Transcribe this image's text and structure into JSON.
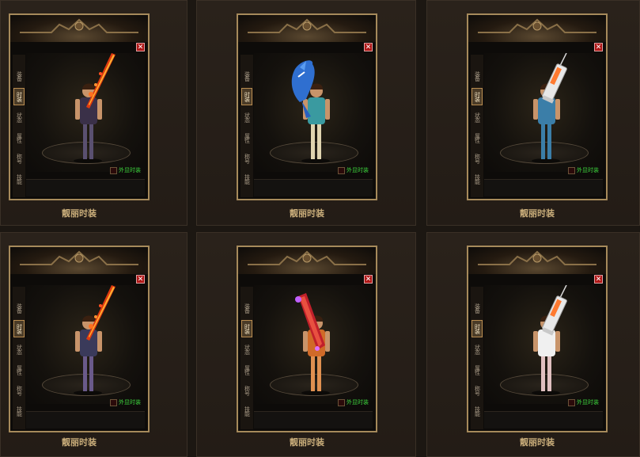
{
  "tabs": [
    "装备",
    "时装",
    "状态",
    "属性",
    "称号",
    "技能"
  ],
  "active_tab_index": 1,
  "close_symbol": "✕",
  "fashion_label": "外显时装",
  "cards": [
    {
      "caption": "靓丽时装",
      "weapon": "flame-sword",
      "outfit": "dark-robe"
    },
    {
      "caption": "靓丽时装",
      "weapon": "shark",
      "outfit": "hawaiian-shirt"
    },
    {
      "caption": "靓丽时装",
      "weapon": "syringe",
      "outfit": "blue-scrubs"
    },
    {
      "caption": "靓丽时装",
      "weapon": "flame-sword",
      "outfit": "dark-dress"
    },
    {
      "caption": "靓丽时装",
      "weapon": "red-blade",
      "outfit": "orange-dress"
    },
    {
      "caption": "靓丽时装",
      "weapon": "syringe",
      "outfit": "nurse-dress"
    }
  ],
  "colors": {
    "frame": "#a68a5b",
    "caption": "#c9ad7a",
    "fashion_label": "#3cd23c",
    "close": "#b01818"
  }
}
